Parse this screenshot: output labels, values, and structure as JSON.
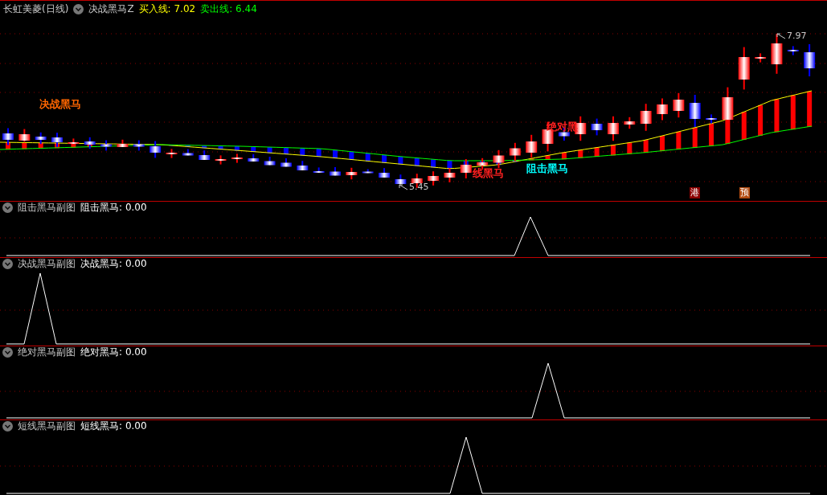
{
  "header": {
    "stock": "长虹美菱(日线)",
    "indicator": "决战黑马Z",
    "values": [
      {
        "label": "买入线:",
        "value": "7.02",
        "color": "#ffff00"
      },
      {
        "label": "卖出线:",
        "value": "6.44",
        "color": "#00ff00"
      }
    ]
  },
  "main_chart": {
    "labels": [
      {
        "text": "决战黑马",
        "color": "#ff6600"
      },
      {
        "text": "绝对黑",
        "color": "#ff2020"
      },
      {
        "text": "阻击黑马",
        "color": "#00ffff"
      },
      {
        "text": "线黑马",
        "color": "#ff2020"
      }
    ],
    "price_marks": [
      {
        "text": "7.97"
      },
      {
        "text": "5.45"
      }
    ],
    "badges": [
      {
        "text": "港",
        "color": "#8b0000"
      },
      {
        "text": "预",
        "color": "#b04a10"
      }
    ]
  },
  "panels": [
    {
      "title": "阻击黑马副图",
      "series": "阻击黑马:",
      "value": "0.00"
    },
    {
      "title": "决战黑马副图",
      "series": "决战黑马:",
      "value": "0.00"
    },
    {
      "title": "绝对黑马副图",
      "series": "绝对黑马:",
      "value": "0.00"
    },
    {
      "title": "短线黑马副图",
      "series": "短线黑马:",
      "value": "0.00"
    }
  ]
}
